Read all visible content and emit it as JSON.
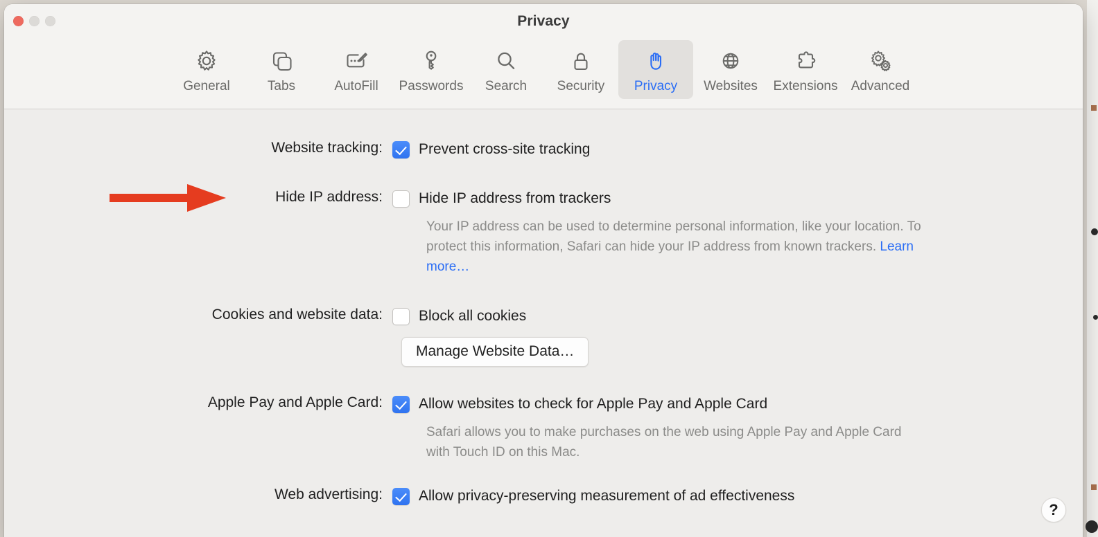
{
  "window": {
    "title": "Privacy",
    "traffic_lights": [
      "close",
      "minimize",
      "maximize"
    ]
  },
  "toolbar": {
    "tabs": [
      {
        "label": "General",
        "icon": "gear-icon",
        "selected": false
      },
      {
        "label": "Tabs",
        "icon": "tabs-icon",
        "selected": false
      },
      {
        "label": "AutoFill",
        "icon": "autofill-icon",
        "selected": false
      },
      {
        "label": "Passwords",
        "icon": "key-icon",
        "selected": false
      },
      {
        "label": "Search",
        "icon": "search-icon",
        "selected": false
      },
      {
        "label": "Security",
        "icon": "lock-icon",
        "selected": false
      },
      {
        "label": "Privacy",
        "icon": "hand-icon",
        "selected": true
      },
      {
        "label": "Websites",
        "icon": "globe-icon",
        "selected": false
      },
      {
        "label": "Extensions",
        "icon": "puzzle-icon",
        "selected": false
      },
      {
        "label": "Advanced",
        "icon": "double-gear-icon",
        "selected": false
      }
    ]
  },
  "settings": {
    "website_tracking": {
      "label": "Website tracking:",
      "checkbox_label": "Prevent cross-site tracking",
      "checked": true
    },
    "hide_ip": {
      "label": "Hide IP address:",
      "checkbox_label": "Hide IP address from trackers",
      "checked": false,
      "description": "Your IP address can be used to determine personal information, like your location. To protect this information, Safari can hide your IP address from known trackers. ",
      "learn_more": "Learn more…"
    },
    "cookies": {
      "label": "Cookies and website data:",
      "checkbox_label": "Block all cookies",
      "checked": false,
      "button_label": "Manage Website Data…"
    },
    "apple_pay": {
      "label": "Apple Pay and Apple Card:",
      "checkbox_label": "Allow websites to check for Apple Pay and Apple Card",
      "checked": true,
      "description": "Safari allows you to make purchases on the web using Apple Pay and Apple Card with Touch ID on this Mac."
    },
    "web_advertising": {
      "label": "Web advertising:",
      "checkbox_label": "Allow privacy-preserving measurement of ad effectiveness",
      "checked": true
    }
  },
  "help_button": {
    "label": "?"
  },
  "annotation": {
    "type": "arrow",
    "color": "#e53c1f",
    "points_to": "Hide IP address:"
  },
  "colors": {
    "accent": "#2a6df5",
    "checkbox_on": "#3478f6",
    "window_bg": "#eeedeb",
    "toolbar_bg": "#f4f3f1",
    "selected_tab_bg": "#e2e0dd",
    "secondary_text": "#8b8b89",
    "annotation_red": "#e53c1f"
  }
}
